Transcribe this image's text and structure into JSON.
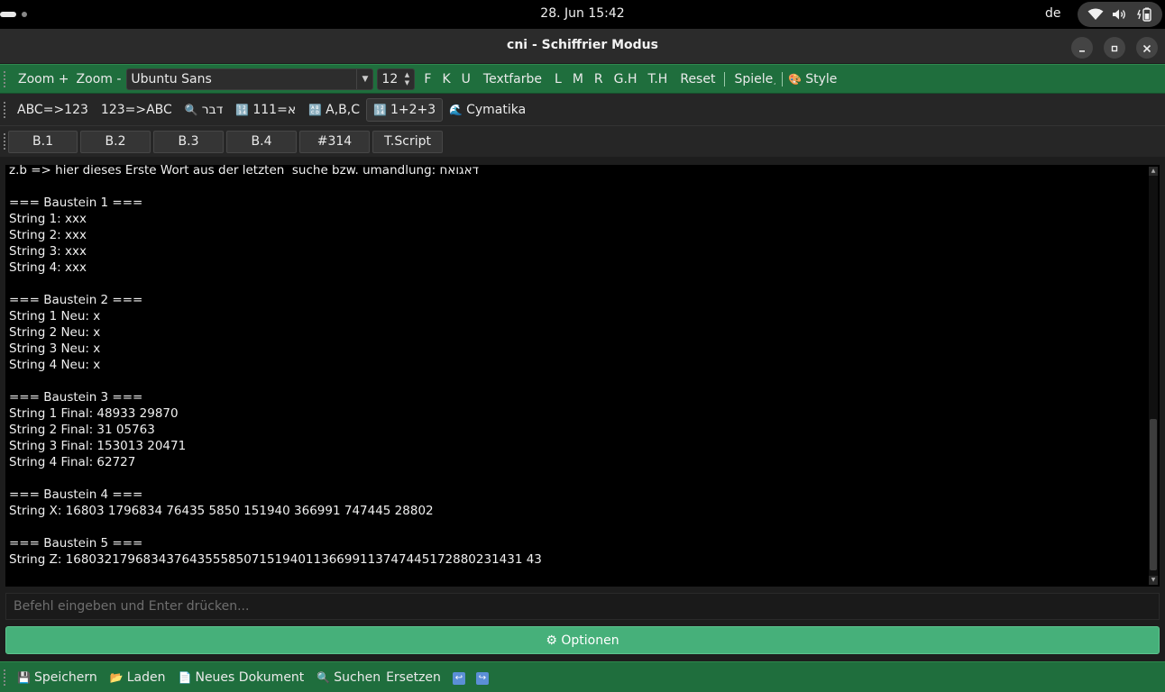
{
  "system": {
    "date_time": "28. Jun  15:42",
    "keyboard_layout": "de"
  },
  "window": {
    "title": "cni - Schiffrier Modus"
  },
  "toolbar1": {
    "zoom_in": "Zoom +",
    "zoom_out": "Zoom -",
    "font_family": "Ubuntu Sans",
    "font_size": "12",
    "bold": "F",
    "italic": "K",
    "underline": "U",
    "text_color": "Textfarbe",
    "align_left": "L",
    "align_middle": "M",
    "align_right": "R",
    "gh": "G.H",
    "th": "T.H",
    "reset": "Reset",
    "games": "Spiele",
    "style": "Style"
  },
  "toolbar2": {
    "abc_to_num": "ABC=>123",
    "num_to_abc": "123=>ABC",
    "search_hebrew": "דבר",
    "aleph_111": "א=111",
    "abc_list": "A,B,C",
    "sum": "1+2+3",
    "cymatika": "Cymatika"
  },
  "toolbar3": {
    "b1": "B.1",
    "b2": "B.2",
    "b3": "B.3",
    "b4": "B.4",
    "pi": "#314",
    "tscript": "T.Script"
  },
  "editor": {
    "lines": [
      "z.b => hier dieses Erste Wort aus der letzten  suche bzw. umandlung: דאגואח",
      "",
      "=== Baustein 1 ===",
      "String 1: xxx",
      "String 2: xxx",
      "String 3: xxx",
      "String 4: xxx",
      "",
      "=== Baustein 2 ===",
      "String 1 Neu: x",
      "String 2 Neu: x",
      "String 3 Neu: x",
      "String 4 Neu: x",
      "",
      "=== Baustein 3 ===",
      "String 1 Final: 48933 29870",
      "String 2 Final: 31 05763",
      "String 3 Final: 153013 20471",
      "String 4 Final: 62727",
      "",
      "=== Baustein 4 ===",
      "String X: 16803 1796834 76435 5850 151940 366991 747445 28802",
      "",
      "=== Baustein 5 ===",
      "String Z: 16803217968343764355585071519401136699113747445172880231431 43"
    ]
  },
  "command": {
    "placeholder": "Befehl eingeben und Enter drücken..."
  },
  "options_button": "⚙ Optionen",
  "bottom_toolbar": {
    "save": "Speichern",
    "load": "Laden",
    "new_doc": "Neues Dokument",
    "search": "Suchen",
    "replace": "Ersetzen"
  }
}
